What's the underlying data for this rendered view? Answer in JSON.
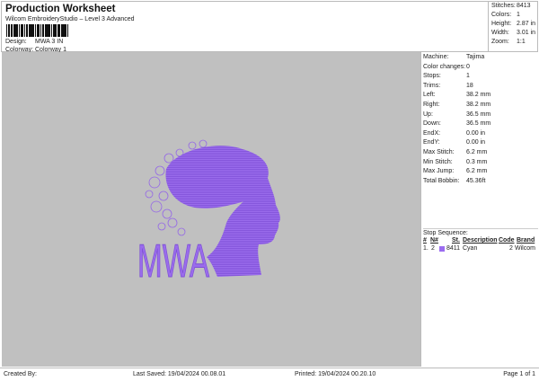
{
  "header": {
    "title": "Production Worksheet",
    "subtitle": "Wilcom EmbroideryStudio – Level 3 Advanced",
    "design_label": "Design:",
    "design_value": "MWA 3 IN",
    "colorway_label": "Colorway:",
    "colorway_value": "Colorway 1"
  },
  "stats": [
    {
      "label": "Stitches:",
      "value": "8413"
    },
    {
      "label": "Colors:",
      "value": "1"
    },
    {
      "label": "Height:",
      "value": "2.87 in"
    },
    {
      "label": "Width:",
      "value": "3.01 in"
    },
    {
      "label": "Zoom:",
      "value": "1:1"
    }
  ],
  "design_preview": {
    "text": "MWA",
    "thread_color": "#9b6cf0"
  },
  "details": [
    {
      "label": "Machine:",
      "value": "Tajima"
    },
    {
      "label": "Color changes:",
      "value": "0"
    },
    {
      "label": "Stops:",
      "value": "1"
    },
    {
      "label": "Trims:",
      "value": "18"
    },
    {
      "label": "Left:",
      "value": "38.2 mm"
    },
    {
      "label": "Right:",
      "value": "38.2 mm"
    },
    {
      "label": "Up:",
      "value": "36.5 mm"
    },
    {
      "label": "Down:",
      "value": "36.5 mm"
    },
    {
      "label": "EndX:",
      "value": "0.00 in"
    },
    {
      "label": "EndY:",
      "value": "0.00 in"
    },
    {
      "label": "Max Stitch:",
      "value": "6.2 mm"
    },
    {
      "label": "Min Stitch:",
      "value": "0.3 mm"
    },
    {
      "label": "Max Jump:",
      "value": "6.2 mm"
    },
    {
      "label": "Total Bobbin:",
      "value": "45.36ft"
    }
  ],
  "stop_sequence": {
    "title": "Stop Sequence:",
    "columns": [
      "#",
      "N#",
      "St.",
      "Description",
      "Code",
      "Brand"
    ],
    "rows": [
      {
        "num": "1.",
        "n": "2",
        "st": "8411",
        "description": "Cyan",
        "code": "2",
        "brand": "Wilcom",
        "color": "#9b6cf0"
      }
    ]
  },
  "footer": {
    "created_by": "Created By:",
    "last_saved": "Last Saved: 19/04/2024 00.08.01",
    "printed": "Printed: 19/04/2024 00.20.10",
    "page": "Page 1 of 1"
  }
}
